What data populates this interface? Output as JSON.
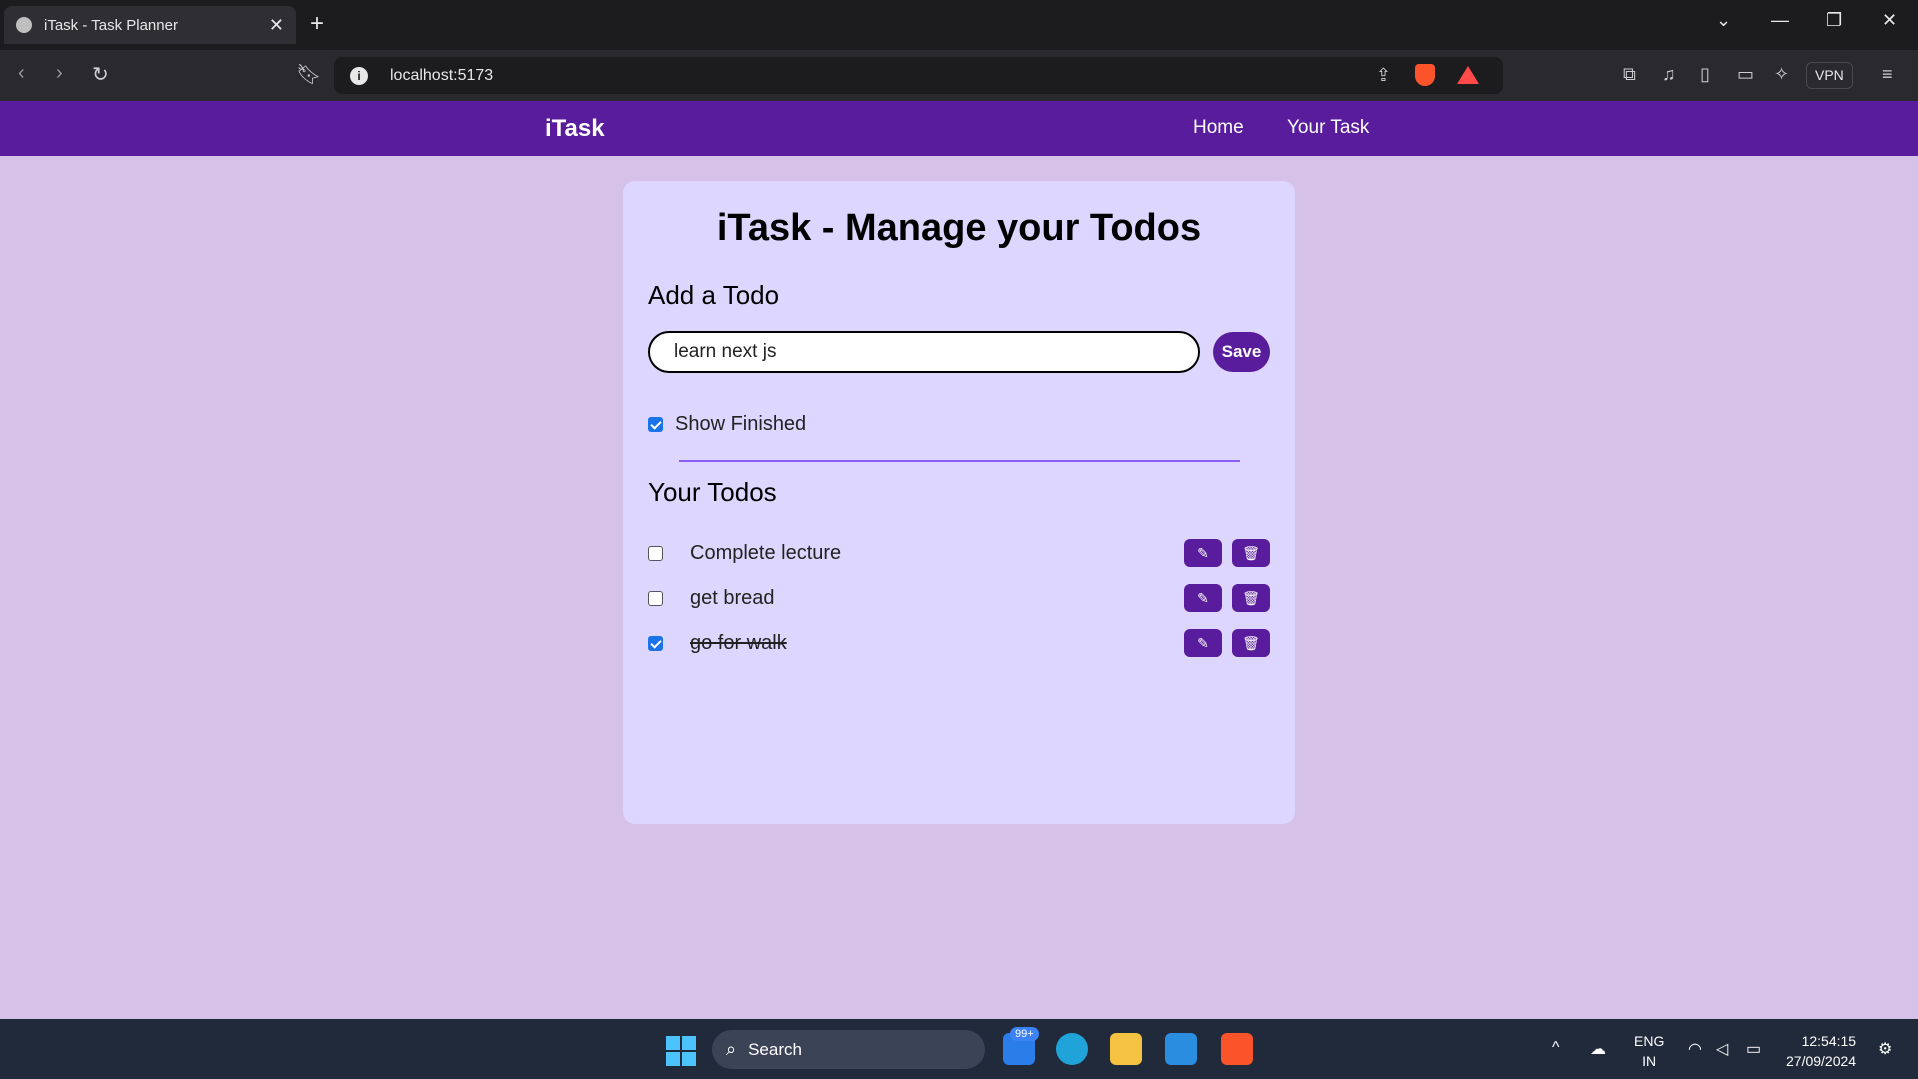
{
  "browser": {
    "tab_title": "iTask - Task Planner",
    "new_tab": "+",
    "address": "localhost:5173",
    "vpn_label": "VPN"
  },
  "app": {
    "logo": "iTask",
    "nav": [
      "Home",
      "Your Task"
    ],
    "title": "iTask - Manage your Todos",
    "add_title": "Add a Todo",
    "input_value": "learn next js",
    "save_label": "Save",
    "show_finished_label": "Show Finished",
    "show_finished_checked": true,
    "todos_title": "Your Todos",
    "todos": [
      {
        "text": "Complete lecture",
        "done": false
      },
      {
        "text": "get bread",
        "done": false
      },
      {
        "text": "go for walk",
        "done": true
      }
    ],
    "accent_color": "#581c9c"
  },
  "taskbar": {
    "search_label": "Search",
    "badge": "99+",
    "lang_top": "ENG",
    "lang_bottom": "IN",
    "time": "12:54:15",
    "date": "27/09/2024"
  },
  "icons": [
    "globe-icon",
    "close-icon",
    "back-icon",
    "forward-icon",
    "reload-icon",
    "bookmark-icon",
    "info-icon",
    "share-icon",
    "edit-icon",
    "delete-icon",
    "windows-icon",
    "search-icon",
    "wifi-icon",
    "volume-icon",
    "battery-icon"
  ]
}
